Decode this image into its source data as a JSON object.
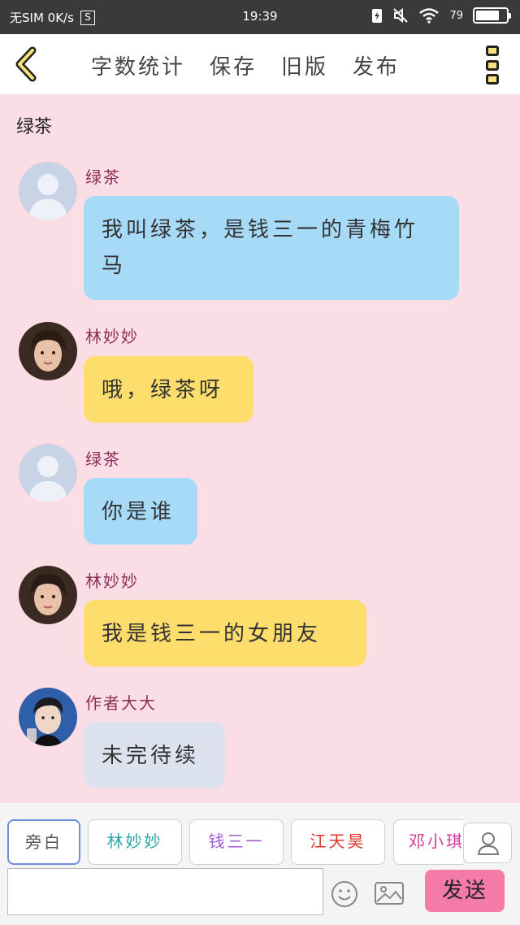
{
  "status_bar": {
    "carrier": "无SIM 0K/s",
    "sim_label": "S",
    "time": "19:39",
    "battery": "79",
    "battery_level": 0.79
  },
  "toolbar": {
    "actions": [
      "字数统计",
      "保存",
      "旧版",
      "发布"
    ]
  },
  "chat": {
    "title": "绿茶",
    "messages": [
      {
        "sender": "绿茶",
        "text": "我叫绿茶，是钱三一的青梅竹马",
        "avatar": "default-avatar",
        "bubble_color": "#a6daf7"
      },
      {
        "sender": "林妙妙",
        "text": "哦，绿茶呀",
        "avatar": "photo-avatar-girl",
        "bubble_color": "#fddd6c"
      },
      {
        "sender": "绿茶",
        "text": "你是谁",
        "avatar": "default-avatar",
        "bubble_color": "#a6daf7"
      },
      {
        "sender": "林妙妙",
        "text": "我是钱三一的女朋友",
        "avatar": "photo-avatar-girl",
        "bubble_color": "#fddd6c"
      },
      {
        "sender": "作者大大",
        "text": "未完待续",
        "avatar": "photo-avatar-boy",
        "bubble_color": "#dde3ee"
      }
    ]
  },
  "composer": {
    "roles": [
      {
        "label": "旁白",
        "color": "#555555"
      },
      {
        "label": "林妙妙",
        "color": "#2aa6a6"
      },
      {
        "label": "钱三一",
        "color": "#a05bd0"
      },
      {
        "label": "江天昊",
        "color": "#e0342c"
      },
      {
        "label": "邓小琪",
        "color": "#d2389a"
      }
    ],
    "input_value": "",
    "send_label": "发送"
  },
  "colors": {
    "background": "#fbdde5",
    "sender_name": "#8a2d57",
    "send_button": "#f47ba7"
  }
}
